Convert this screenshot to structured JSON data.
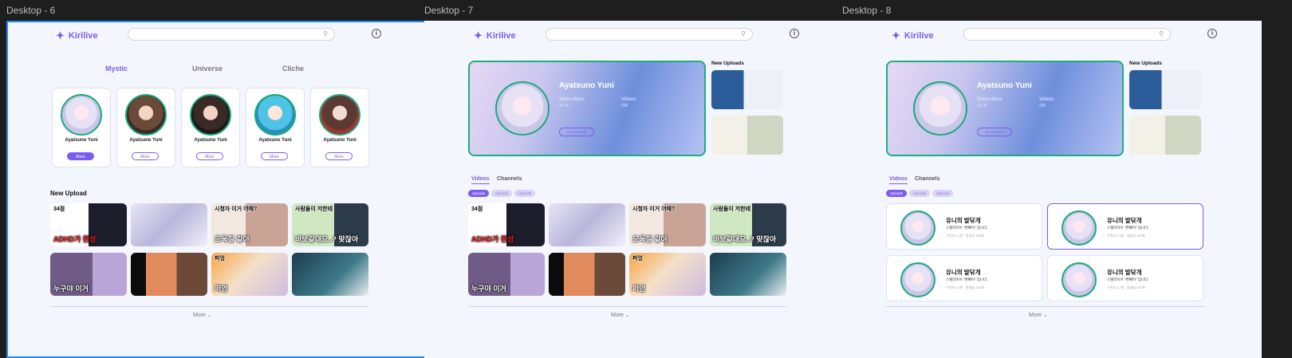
{
  "frames": [
    {
      "label": "Desktop - 6"
    },
    {
      "label": "Desktop - 7"
    },
    {
      "label": "Desktop - 8"
    }
  ],
  "header": {
    "brand": "Kirilive",
    "search_placeholder": "",
    "search_icon": "search-icon",
    "info_icon": "info-icon"
  },
  "categories": [
    "Mystic",
    "Universe",
    "Cliche"
  ],
  "vtubers": [
    {
      "name": "Ayatsuno Yuni",
      "more": "More"
    },
    {
      "name": "Ayatsuno Yuni",
      "more": "More"
    },
    {
      "name": "Ayatsuno Yuni",
      "more": "More"
    },
    {
      "name": "Ayatsuno Yuni",
      "more": "More"
    },
    {
      "name": "Ayatsuno Yuni",
      "more": "More"
    }
  ],
  "new_upload": {
    "title": "New Upload",
    "thumbs": [
      {
        "caption_top": "34점",
        "caption": "ADHD가 완성"
      },
      {
        "caption_top": "",
        "caption": ""
      },
      {
        "caption_top": "시청자 이거 어때?",
        "caption": "도둑질 같아"
      },
      {
        "caption_top": "사람들이 저한테",
        "caption": "바보같대요..? 맞잖아"
      },
      {
        "caption_top": "",
        "caption": "누구야 이거"
      },
      {
        "caption_top": "",
        "caption": ""
      },
      {
        "caption_top": "퍼엉",
        "caption": "퍼엉"
      },
      {
        "caption_top": "",
        "caption": ""
      }
    ],
    "more": "More ⌄"
  },
  "feature": {
    "name": "Ayatsuno Yuni",
    "subscribers_label": "Subscribers",
    "subscribers_value": "23.3k",
    "videos_label": "Videos",
    "videos_value": "230",
    "go_channel": "Go Channel"
  },
  "new_uploads_title": "New Uploads",
  "subtabs": [
    "Videos",
    "Channels"
  ],
  "pills": [
    "Uploads",
    "Uploads",
    "Uploads"
  ],
  "channels": [
    {
      "title": "유니의 발닦개",
      "desc": "스텔라이브 \"변뻬이\" 입니다.",
      "stats": "구독자 1.2만 · 동영상 100개"
    },
    {
      "title": "유니의 발닦개",
      "desc": "스텔라이브 \"변뻬이\" 입니다.",
      "stats": "구독자 1.2만 · 동영상 100개"
    },
    {
      "title": "유니의 발닦개",
      "desc": "스텔라이브 \"변뻬이\" 입니다.",
      "stats": "구독자 1.2만 · 동영상 100개"
    },
    {
      "title": "유니의 발닦개",
      "desc": "스텔라이브 \"변뻬이\" 입니다.",
      "stats": "구독자 1.2만 · 동영상 100개"
    }
  ],
  "colors": {
    "accent": "#7b5cf0",
    "avatar_ring": "#19a97c",
    "selection": "#1f8ef1",
    "canvas": "#1e1e1e"
  }
}
